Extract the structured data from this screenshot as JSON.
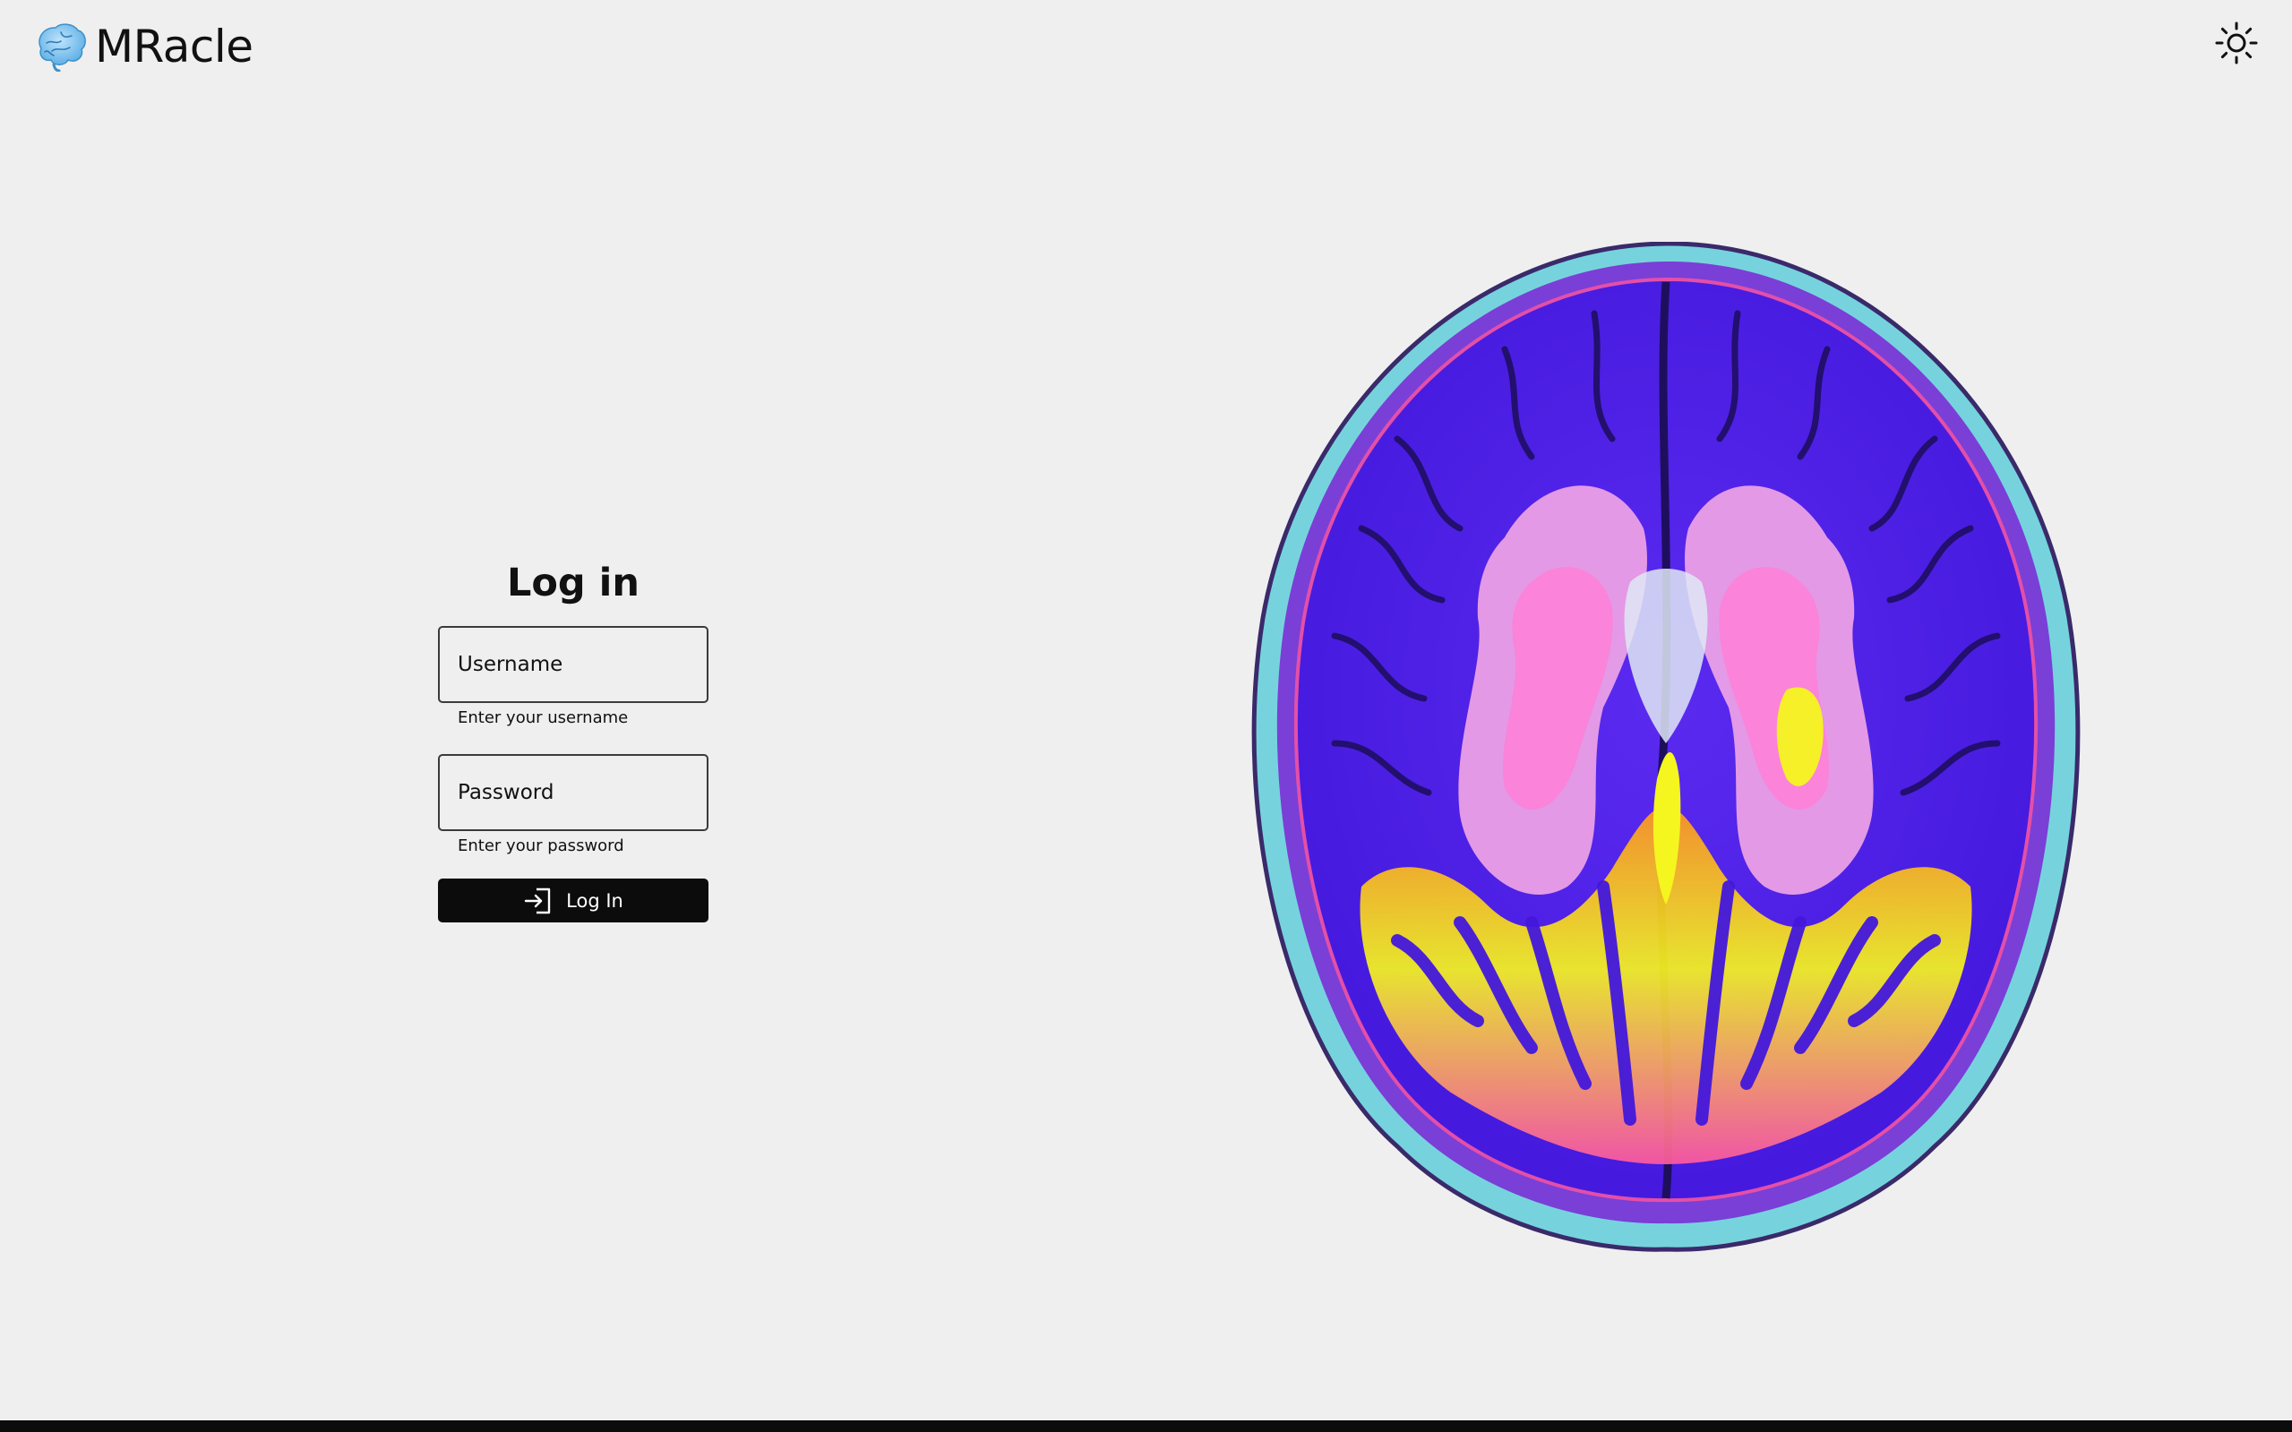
{
  "app": {
    "name": "MRacle",
    "logo_icon": "brain-logo-icon"
  },
  "header": {
    "theme_toggle_icon": "sun-icon"
  },
  "login": {
    "title": "Log in",
    "username": {
      "placeholder": "Username",
      "value": "",
      "helper": "Enter your username"
    },
    "password": {
      "placeholder": "Password",
      "value": "",
      "helper": "Enter your password"
    },
    "submit": {
      "label": "Log In",
      "icon": "log-in-icon"
    }
  },
  "illustration": {
    "name": "brain-mri-scan-image"
  },
  "colors": {
    "background": "#efefef",
    "button": "#0c0c0c",
    "button_text": "#ffffff",
    "border": "#3b3b3b",
    "brain_main": "#4a1ee8",
    "brain_highlight_yellow": "#f2f21e",
    "brain_highlight_pink": "#f06ad2",
    "brain_rim": "#6fd6dc"
  }
}
